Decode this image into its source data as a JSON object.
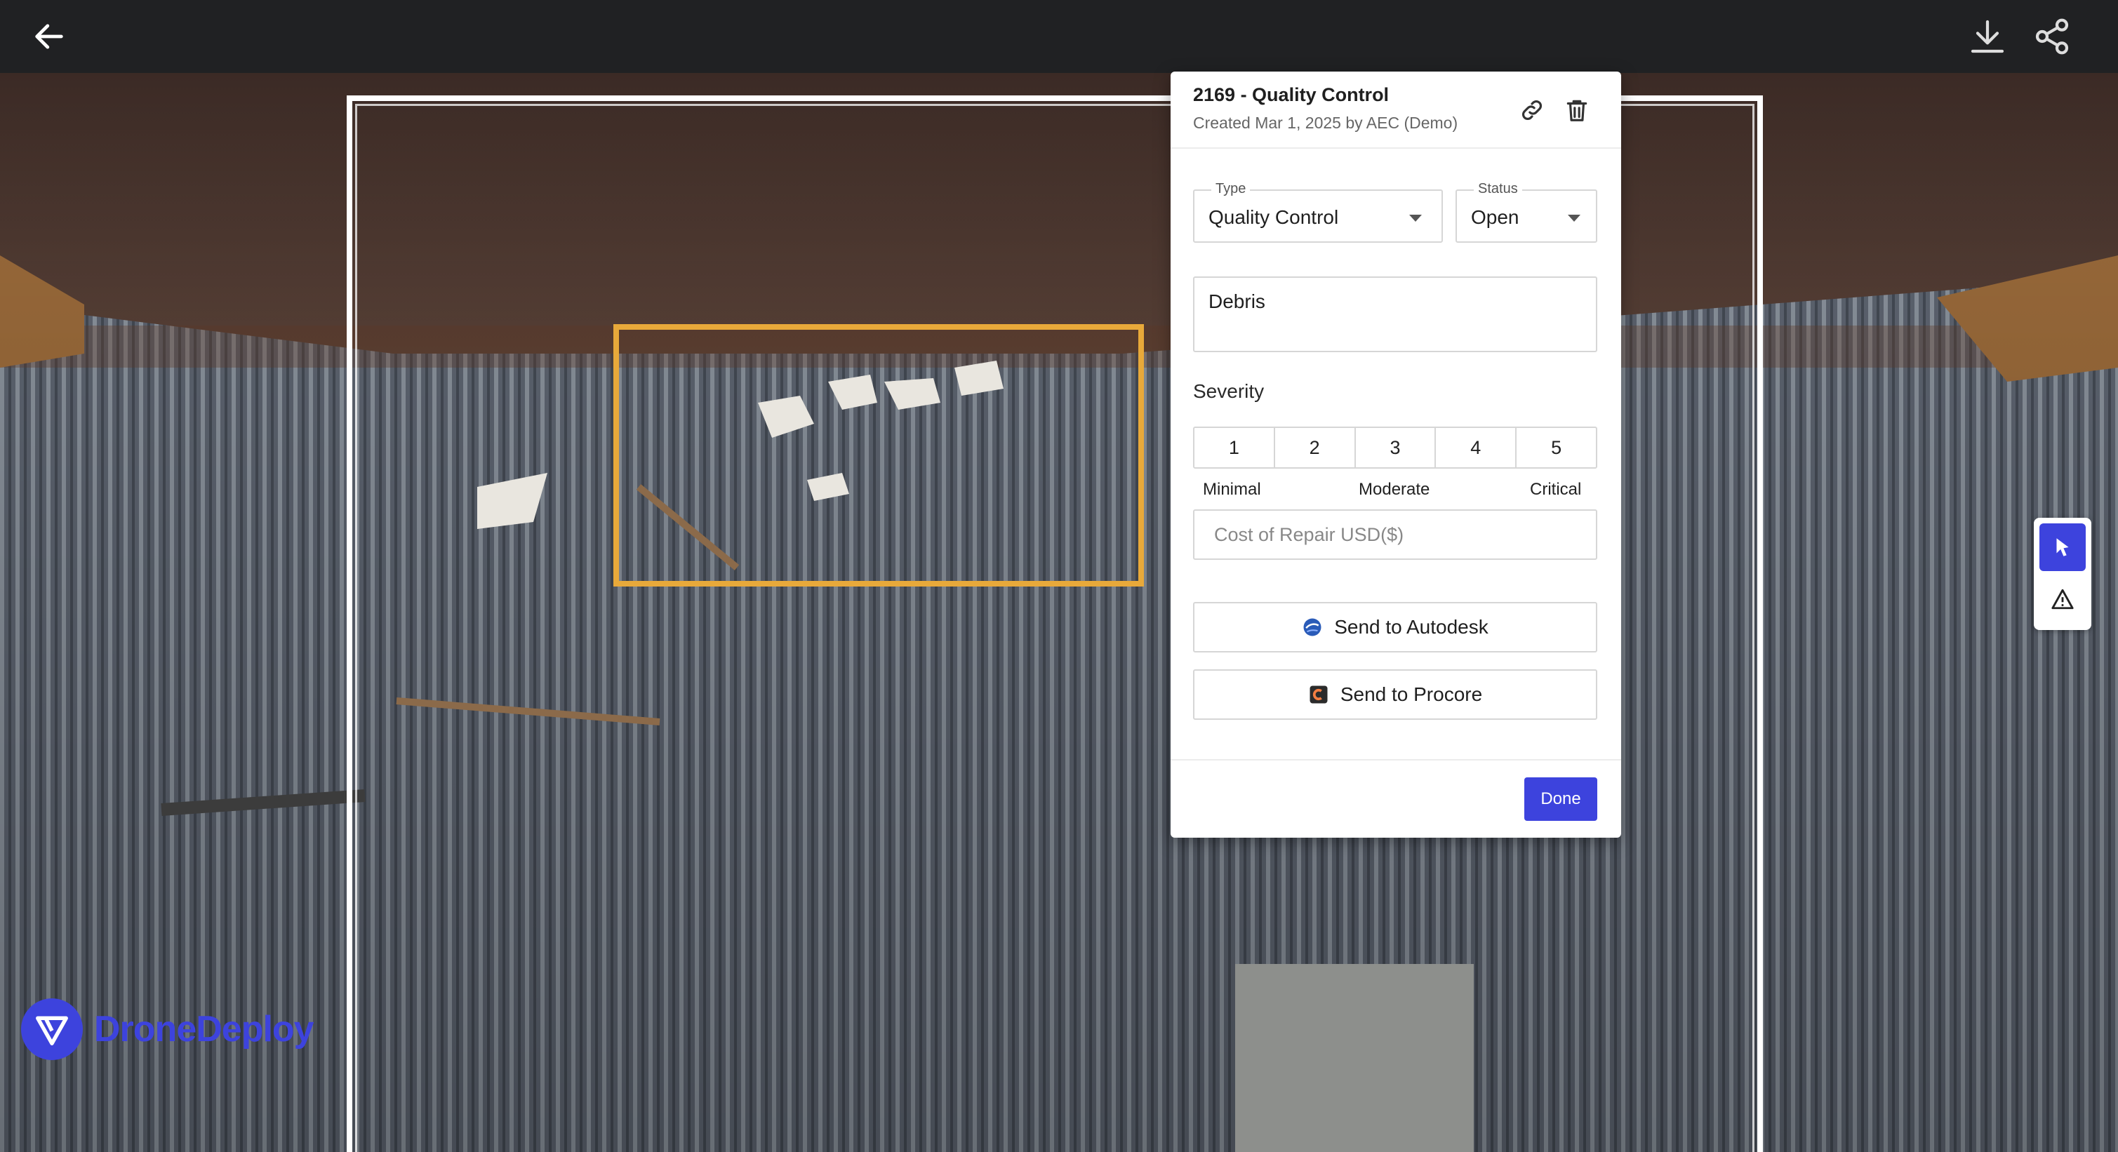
{
  "topbar": {
    "back_icon": "arrow-left-icon",
    "download_icon": "download-icon",
    "share_icon": "share-icon"
  },
  "logo": {
    "text": "DroneDeploy"
  },
  "issue": {
    "title": "2169 - Quality Control",
    "subtitle": "Created Mar 1, 2025 by AEC (Demo)",
    "link_icon": "link-icon",
    "delete_icon": "trash-icon",
    "type": {
      "label": "Type",
      "value": "Quality Control"
    },
    "status": {
      "label": "Status",
      "value": "Open"
    },
    "name_value": "Debris",
    "severity": {
      "label": "Severity",
      "levels": [
        "1",
        "2",
        "3",
        "4",
        "5"
      ],
      "min_label": "Minimal",
      "mid_label": "Moderate",
      "max_label": "Critical"
    },
    "cost": {
      "placeholder": "Cost of Repair USD($)",
      "value": ""
    },
    "send_autodesk": "Send to Autodesk",
    "send_procore": "Send to Procore",
    "done": "Done"
  },
  "tools": {
    "select_icon": "cursor-icon",
    "issue_icon": "warning-icon"
  },
  "colors": {
    "accent": "#3d43dd",
    "annotation": "#e8a93a",
    "topbar": "#202123"
  }
}
